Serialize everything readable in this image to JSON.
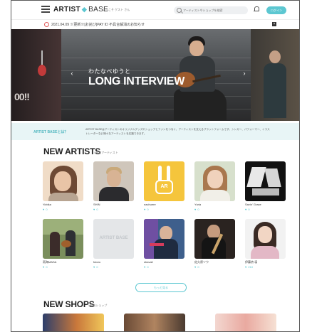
{
  "header": {
    "logo_main": "ARTIST",
    "logo_sub": "BASE",
    "tagline": "ようこそ ゲスト さん",
    "search_placeholder": "アーティストやショップを検索",
    "login_label": "ログイン"
  },
  "notice": {
    "text": "2021.04.09 ※更新※[お詫び]PAY ID 不具合解消のお知らせ",
    "close_label": "×"
  },
  "hero": {
    "subtitle": "わたなべゆうと",
    "title": "LONG INTERVIEW",
    "left_text": "00!!",
    "prev": "‹",
    "next": "›"
  },
  "about": {
    "label": "ARTIST BASEとは？",
    "text": "ARTIST BASEはアーティストのオリジナルグッズやショップとファンをつなぐ、アーティストを支えるプラットフォームです。シンガー、パフォーマー、イラストレーターなど様々なアーティストを応援できます。"
  },
  "new_artists": {
    "title": "NEW ARTISTS",
    "subtitle": "/ 新着アーティスト",
    "more_label": "もっと見る",
    "items": [
      {
        "name": "Yobika",
        "likes": "0"
      },
      {
        "name": "SHIN",
        "likes": "0"
      },
      {
        "name": "nachuere",
        "likes": "0"
      },
      {
        "name": "Yuria",
        "likes": "0"
      },
      {
        "name": "Savin' Grace",
        "likes": "0"
      },
      {
        "name": "雨海MASA",
        "likes": "0"
      },
      {
        "name": "futoru",
        "likes": "0"
      },
      {
        "name": "shavali",
        "likes": "0"
      },
      {
        "name": "佐久原ソウ",
        "likes": "0"
      },
      {
        "name": "伊藤詩 凛",
        "likes": "210"
      }
    ],
    "placeholder_logo": "ARTIST BASE",
    "badge_text": "AR"
  },
  "new_shops": {
    "title": "NEW SHOPS",
    "subtitle": "/ 新着ショップ"
  },
  "colors": {
    "accent": "#5cc7d1",
    "about_bg": "#e8f5f6"
  }
}
